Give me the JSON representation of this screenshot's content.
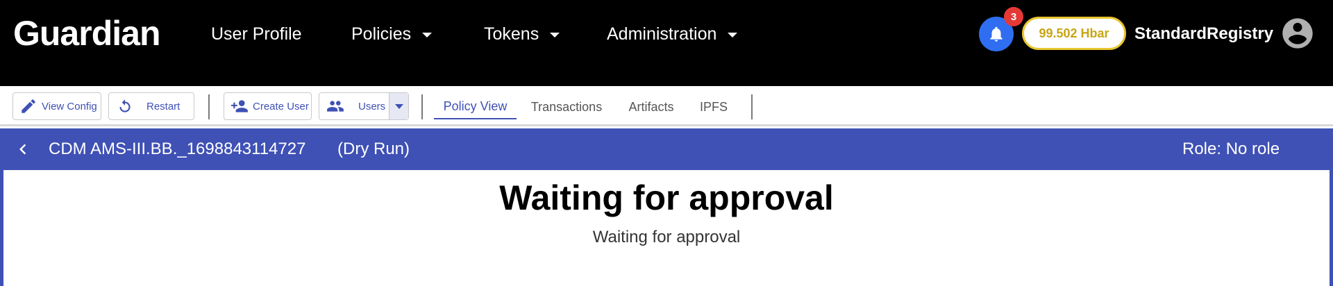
{
  "header": {
    "logo": "Guardian",
    "nav": [
      {
        "label": "User Profile",
        "has_dropdown": false
      },
      {
        "label": "Policies",
        "has_dropdown": true
      },
      {
        "label": "Tokens",
        "has_dropdown": true
      },
      {
        "label": "Administration",
        "has_dropdown": true
      }
    ],
    "notifications_count": "3",
    "balance": "99.502 Hbar",
    "username": "StandardRegistry"
  },
  "toolbar": {
    "view_config_label": "View Config",
    "restart_label": "Restart",
    "create_user_label": "Create User",
    "users_label": "Users",
    "tabs": [
      {
        "label": "Policy View",
        "active": true
      },
      {
        "label": "Transactions",
        "active": false
      },
      {
        "label": "Artifacts",
        "active": false
      },
      {
        "label": "IPFS",
        "active": false
      }
    ]
  },
  "policy": {
    "name": "CDM AMS-III.BB._1698843114727",
    "mode": "(Dry Run)",
    "role": "Role: No role"
  },
  "content": {
    "title": "Waiting for approval",
    "subtitle": "Waiting for approval"
  },
  "colors": {
    "accent": "#3f51b5",
    "header_bg": "#000000",
    "notification_blue": "#2f6ef0",
    "badge_red": "#e53935",
    "balance_gold": "#e8c62e"
  }
}
